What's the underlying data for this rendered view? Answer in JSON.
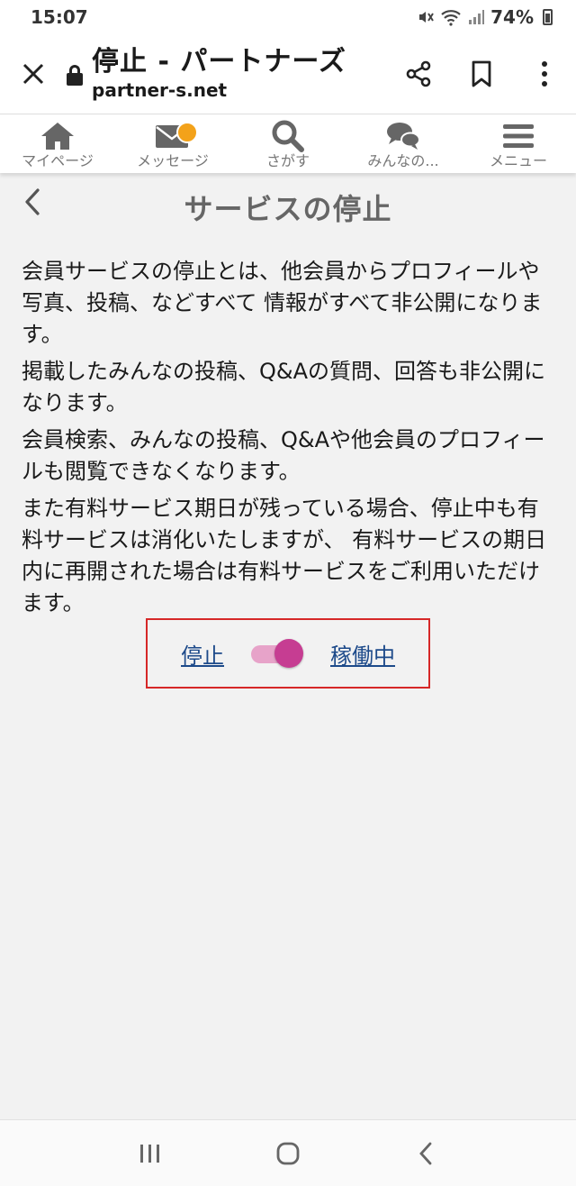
{
  "status_bar": {
    "time": "15:07",
    "battery_percent": "74%",
    "icons": [
      "mute-icon",
      "wifi-icon",
      "signal-icon",
      "battery-icon"
    ]
  },
  "browser": {
    "page_title": "停止 - パートナーズ",
    "url": "partner-s.net",
    "close_label": "✕",
    "icons": [
      "close-icon",
      "lock-icon",
      "share-icon",
      "bookmark-icon",
      "more-vert-icon"
    ]
  },
  "site_nav": {
    "items": [
      {
        "label": "マイページ",
        "icon": "home-icon"
      },
      {
        "label": "メッセージ",
        "icon": "mail-icon",
        "badge": true
      },
      {
        "label": "さがす",
        "icon": "search-icon"
      },
      {
        "label": "みんなの...",
        "icon": "chat-icon"
      },
      {
        "label": "メニュー",
        "icon": "menu-icon"
      }
    ],
    "badge_color": "#f3a21a"
  },
  "header": {
    "back": "<",
    "title": "サービスの停止"
  },
  "body": {
    "p1": "会員サービスの停止とは、他会員からプロフィールや写真、投稿、などすべて 情報がすべて非公開になります。",
    "p2": "掲載したみんなの投稿、Q&Aの質問、回答も非公開になります。",
    "p3": "会員検索、みんなの投稿、Q&Aや他会員のプロフィールも閲覧できなくなります。",
    "p4": "また有料サービス期日が残っている場合、停止中も有料サービスは消化いたしますが、 有料サービスの期日内に再開された場合は有料サービスをご利用いただけます。"
  },
  "toggle": {
    "off_label": "停止",
    "on_label": "稼働中",
    "state": "on",
    "accent_color": "#c63d92",
    "highlight_color": "#d62828"
  },
  "android_nav": {
    "icons": [
      "recents-icon",
      "home-button-icon",
      "back-icon"
    ]
  }
}
